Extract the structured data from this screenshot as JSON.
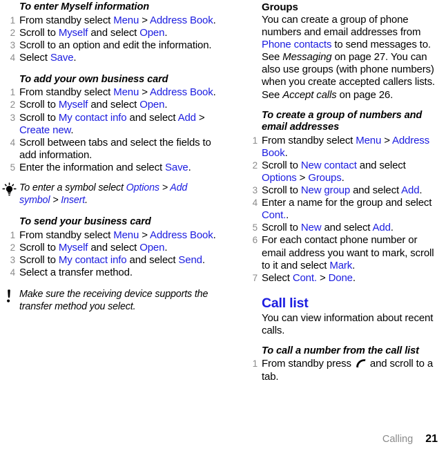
{
  "footer": {
    "chapter": "Calling",
    "page": "21"
  },
  "colors": {
    "link": "#1b1ce0",
    "number": "#8a8a8a",
    "text": "#000000"
  },
  "left_column": {
    "proc1": {
      "heading": "To enter Myself information",
      "steps": [
        {
          "num": "1",
          "parts": [
            {
              "t": "From standby select ",
              "s": "plain"
            },
            {
              "t": "Menu",
              "s": "link"
            },
            {
              "t": " > ",
              "s": "plain"
            },
            {
              "t": "Address Book",
              "s": "link"
            },
            {
              "t": ".",
              "s": "plain"
            }
          ]
        },
        {
          "num": "2",
          "parts": [
            {
              "t": "Scroll to ",
              "s": "plain"
            },
            {
              "t": "Myself",
              "s": "link"
            },
            {
              "t": " and select ",
              "s": "plain"
            },
            {
              "t": "Open",
              "s": "link"
            },
            {
              "t": ".",
              "s": "plain"
            }
          ]
        },
        {
          "num": "3",
          "parts": [
            {
              "t": "Scroll to an option and edit the information.",
              "s": "plain"
            }
          ]
        },
        {
          "num": "4",
          "parts": [
            {
              "t": "Select ",
              "s": "plain"
            },
            {
              "t": "Save",
              "s": "link"
            },
            {
              "t": ".",
              "s": "plain"
            }
          ]
        }
      ]
    },
    "proc2": {
      "heading": "To add your own business card",
      "steps": [
        {
          "num": "1",
          "parts": [
            {
              "t": "From standby select ",
              "s": "plain"
            },
            {
              "t": "Menu",
              "s": "link"
            },
            {
              "t": " > ",
              "s": "plain"
            },
            {
              "t": "Address Book",
              "s": "link"
            },
            {
              "t": ".",
              "s": "plain"
            }
          ]
        },
        {
          "num": "2",
          "parts": [
            {
              "t": "Scroll to ",
              "s": "plain"
            },
            {
              "t": "Myself",
              "s": "link"
            },
            {
              "t": " and select ",
              "s": "plain"
            },
            {
              "t": "Open",
              "s": "link"
            },
            {
              "t": ".",
              "s": "plain"
            }
          ]
        },
        {
          "num": "3",
          "parts": [
            {
              "t": "Scroll to ",
              "s": "plain"
            },
            {
              "t": "My contact info",
              "s": "link"
            },
            {
              "t": " and select ",
              "s": "plain"
            },
            {
              "t": "Add",
              "s": "link"
            },
            {
              "t": " > ",
              "s": "plain"
            },
            {
              "t": "Create new",
              "s": "link"
            },
            {
              "t": ".",
              "s": "plain"
            }
          ]
        },
        {
          "num": "4",
          "parts": [
            {
              "t": "Scroll between tabs and select the fields to add information.",
              "s": "plain"
            }
          ]
        },
        {
          "num": "5",
          "parts": [
            {
              "t": "Enter the information and select ",
              "s": "plain"
            },
            {
              "t": "Save",
              "s": "link"
            },
            {
              "t": ".",
              "s": "plain"
            }
          ]
        }
      ]
    },
    "tip": {
      "icon": "lightbulb-tip-icon",
      "parts": [
        {
          "t": "To enter a symbol select ",
          "s": "italic"
        },
        {
          "t": "Options",
          "s": "link"
        },
        {
          "t": " > ",
          "s": "plain"
        },
        {
          "t": "Add symbol",
          "s": "link"
        },
        {
          "t": " > ",
          "s": "plain"
        },
        {
          "t": "Insert",
          "s": "link"
        },
        {
          "t": ".",
          "s": "plain"
        }
      ]
    },
    "proc3": {
      "heading": "To send your business card",
      "steps": [
        {
          "num": "1",
          "parts": [
            {
              "t": "From standby select ",
              "s": "plain"
            },
            {
              "t": "Menu",
              "s": "link"
            },
            {
              "t": " > ",
              "s": "plain"
            },
            {
              "t": "Address Book",
              "s": "link"
            },
            {
              "t": ".",
              "s": "plain"
            }
          ]
        },
        {
          "num": "2",
          "parts": [
            {
              "t": "Scroll to ",
              "s": "plain"
            },
            {
              "t": "Myself",
              "s": "link"
            },
            {
              "t": " and select ",
              "s": "plain"
            },
            {
              "t": "Open",
              "s": "link"
            },
            {
              "t": ".",
              "s": "plain"
            }
          ]
        },
        {
          "num": "3",
          "parts": [
            {
              "t": "Scroll to ",
              "s": "plain"
            },
            {
              "t": "My contact info",
              "s": "link"
            },
            {
              "t": " and select ",
              "s": "plain"
            },
            {
              "t": "Send",
              "s": "link"
            },
            {
              "t": ".",
              "s": "plain"
            }
          ]
        },
        {
          "num": "4",
          "parts": [
            {
              "t": "Select a transfer method.",
              "s": "plain"
            }
          ]
        }
      ]
    },
    "note": {
      "icon": "exclamation-note-icon",
      "parts": [
        {
          "t": "Make sure the receiving device supports the transfer method you select.",
          "s": "italic"
        }
      ]
    }
  },
  "right_column": {
    "groups": {
      "heading": "Groups",
      "body_parts": [
        {
          "t": "You can create a group of phone numbers and email addresses from ",
          "s": "plain"
        },
        {
          "t": "Phone contacts",
          "s": "link"
        },
        {
          "t": " to send messages to. See ",
          "s": "plain"
        },
        {
          "t": "Messaging",
          "s": "italic"
        },
        {
          "t": " on page 27. You can also use groups (with phone numbers) when you create accepted callers lists. See ",
          "s": "plain"
        },
        {
          "t": "Accept calls",
          "s": "italic"
        },
        {
          "t": " on page 26.",
          "s": "plain"
        }
      ]
    },
    "proc4": {
      "heading": "To create a group of numbers and email addresses",
      "steps": [
        {
          "num": "1",
          "parts": [
            {
              "t": "From standby select ",
              "s": "plain"
            },
            {
              "t": "Menu",
              "s": "link"
            },
            {
              "t": " > ",
              "s": "plain"
            },
            {
              "t": "Address Book",
              "s": "link"
            },
            {
              "t": ".",
              "s": "plain"
            }
          ]
        },
        {
          "num": "2",
          "parts": [
            {
              "t": "Scroll to ",
              "s": "plain"
            },
            {
              "t": "New contact",
              "s": "link"
            },
            {
              "t": " and select ",
              "s": "plain"
            },
            {
              "t": "Options",
              "s": "link"
            },
            {
              "t": " > ",
              "s": "plain"
            },
            {
              "t": "Groups",
              "s": "link"
            },
            {
              "t": ".",
              "s": "plain"
            }
          ]
        },
        {
          "num": "3",
          "parts": [
            {
              "t": "Scroll to ",
              "s": "plain"
            },
            {
              "t": "New group",
              "s": "link"
            },
            {
              "t": " and select ",
              "s": "plain"
            },
            {
              "t": "Add",
              "s": "link"
            },
            {
              "t": ".",
              "s": "plain"
            }
          ]
        },
        {
          "num": "4",
          "parts": [
            {
              "t": "Enter a name for the group and select ",
              "s": "plain"
            },
            {
              "t": "Cont.",
              "s": "link"
            },
            {
              "t": ".",
              "s": "plain"
            }
          ]
        },
        {
          "num": "5",
          "parts": [
            {
              "t": "Scroll to ",
              "s": "plain"
            },
            {
              "t": "New",
              "s": "link"
            },
            {
              "t": " and select ",
              "s": "plain"
            },
            {
              "t": "Add",
              "s": "link"
            },
            {
              "t": ".",
              "s": "plain"
            }
          ]
        },
        {
          "num": "6",
          "parts": [
            {
              "t": "For each contact phone number or email address you want to mark, scroll to it and select ",
              "s": "plain"
            },
            {
              "t": "Mark",
              "s": "link"
            },
            {
              "t": ".",
              "s": "plain"
            }
          ]
        },
        {
          "num": "7",
          "parts": [
            {
              "t": "Select ",
              "s": "plain"
            },
            {
              "t": "Cont.",
              "s": "link"
            },
            {
              "t": " > ",
              "s": "plain"
            },
            {
              "t": "Done",
              "s": "link"
            },
            {
              "t": ".",
              "s": "plain"
            }
          ]
        }
      ]
    },
    "calllist": {
      "heading": "Call list",
      "body_parts": [
        {
          "t": "You can view information about recent calls.",
          "s": "plain"
        }
      ]
    },
    "proc5": {
      "heading": "To call a number from the call list",
      "steps": [
        {
          "num": "1",
          "parts": [
            {
              "t": "From standby press ",
              "s": "plain"
            },
            {
              "t": "",
              "s": "callkey"
            },
            {
              "t": " and scroll to a tab.",
              "s": "plain"
            }
          ]
        }
      ]
    }
  }
}
